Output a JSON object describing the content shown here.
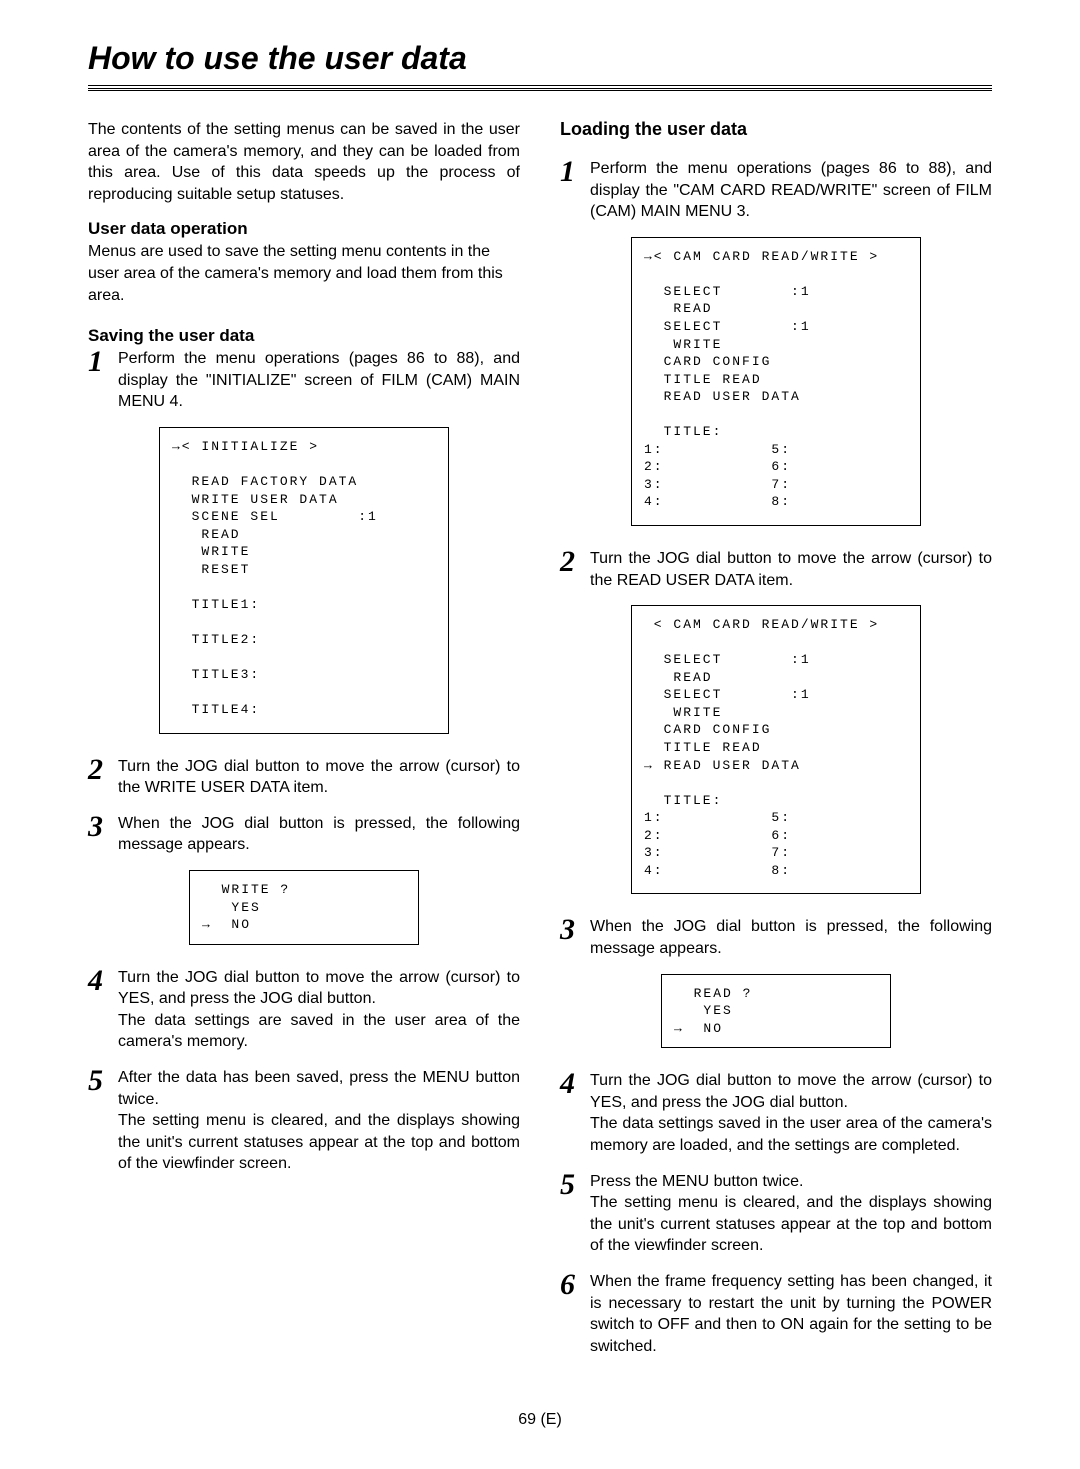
{
  "page": {
    "title": "How to use the user data",
    "footer": "69 (E)"
  },
  "left": {
    "intro": "The contents of the setting menus can be saved in the user area of the camera's memory, and they can be loaded from this area.  Use of this data speeds up the process of reproducing suitable setup statuses.",
    "user_data_op_head": "User data operation",
    "user_data_op_body": "Menus are used to save the setting menu contents in the user area of the camera's memory and load them from this area.",
    "saving_head": "Saving the user data",
    "steps": {
      "s1": "Perform the menu operations (pages 86 to 88), and display the \"INITIALIZE\" screen of FILM (CAM) MAIN MENU 4.",
      "s2": "Turn the JOG dial button to move the arrow (cursor) to the WRITE USER DATA item.",
      "s3": "When the JOG dial button is pressed, the following message appears.",
      "s4": "Turn the JOG dial button to move the arrow (cursor) to YES, and press the JOG dial button.\nThe data settings are saved in the user area of the camera's memory.",
      "s5": "After the data has been saved, press the MENU button twice.\nThe setting menu is cleared, and the displays showing the unit's current statuses appear at the top and bottom of the viewfinder screen."
    },
    "screens": {
      "initialize": "→< INITIALIZE >\n\n  READ FACTORY DATA\n  WRITE USER DATA\n  SCENE SEL        :1\n   READ\n   WRITE\n   RESET\n\n  TITLE1:\n\n  TITLE2:\n\n  TITLE3:\n\n  TITLE4:",
      "write_prompt": "  WRITE ?\n   YES\n→  NO"
    }
  },
  "right": {
    "loading_head": "Loading the user data",
    "steps": {
      "s1": "Perform the menu operations (pages 86 to 88), and display the \"CAM CARD READ/WRITE\" screen of FILM (CAM) MAIN MENU 3.",
      "s2": "Turn the JOG dial button to move the arrow (cursor) to the READ USER DATA item.",
      "s3": "When the JOG dial button is pressed, the following message appears.",
      "s4": "Turn the JOG dial button to move the arrow (cursor) to YES, and press the JOG dial button.\nThe data settings saved in the user area of the camera's memory are loaded, and the settings are completed.",
      "s5": "Press the MENU button twice.\nThe setting menu is cleared, and the displays showing the unit's current statuses appear at the top and bottom of the viewfinder screen.",
      "s6": "When the frame frequency setting has been changed, it is necessary to restart the unit by turning the POWER switch to OFF and then to ON again for the setting to be switched."
    },
    "screens": {
      "cam1": "→< CAM CARD READ/WRITE >\n\n  SELECT       :1\n   READ\n  SELECT       :1\n   WRITE\n  CARD CONFIG\n  TITLE READ\n  READ USER DATA\n\n  TITLE:\n1:           5:\n2:           6:\n3:           7:\n4:           8:",
      "cam2": " < CAM CARD READ/WRITE >\n\n  SELECT       :1\n   READ\n  SELECT       :1\n   WRITE\n  CARD CONFIG\n  TITLE READ\n→ READ USER DATA\n\n  TITLE:\n1:           5:\n2:           6:\n3:           7:\n4:           8:",
      "read_prompt": "  READ ?\n   YES\n→  NO"
    }
  }
}
